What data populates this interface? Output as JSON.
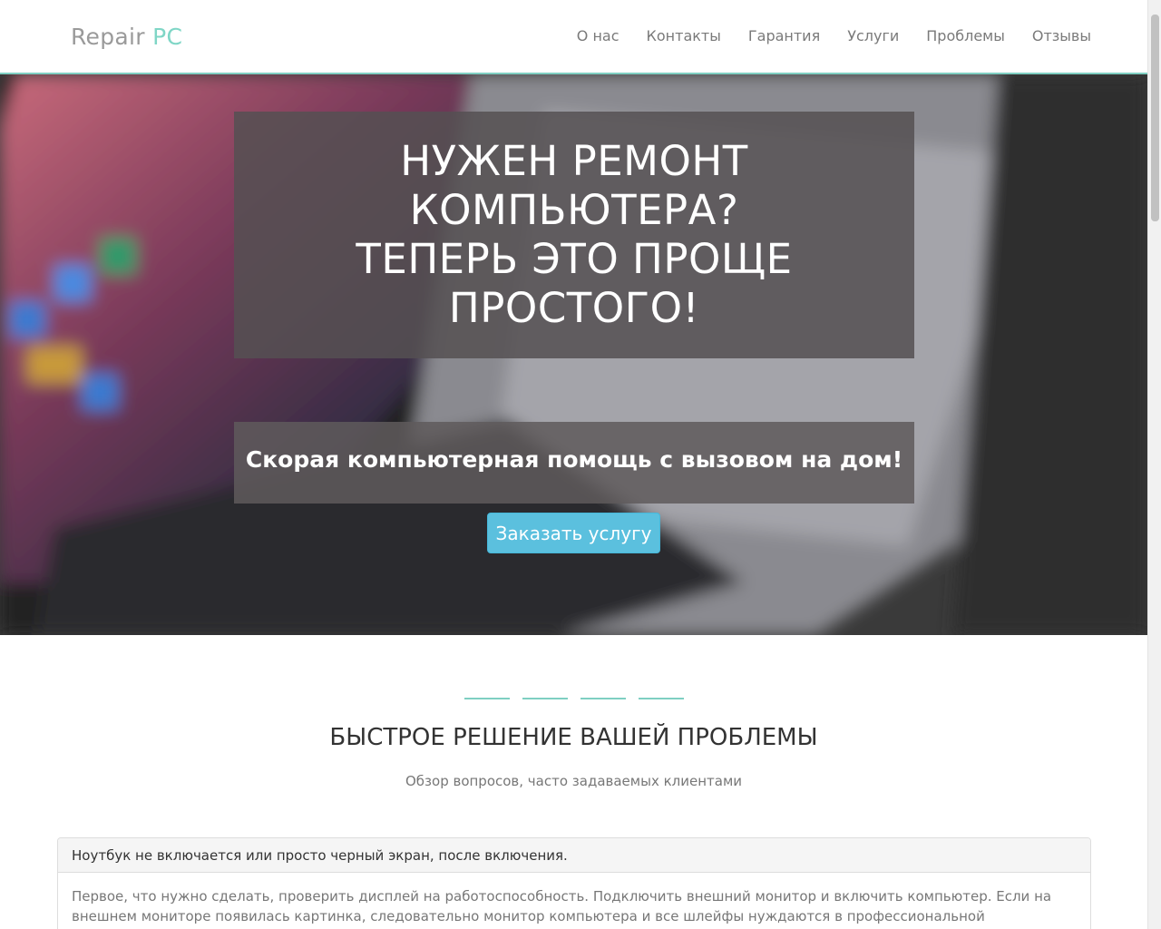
{
  "navbar": {
    "brand_main": "Repair",
    "brand_accent": "PC",
    "links": [
      "О нас",
      "Контакты",
      "Гарантия",
      "Услуги",
      "Проблемы",
      "Отзывы"
    ]
  },
  "hero": {
    "title_line1": "НУЖЕН РЕМОНТ",
    "title_line2": "КОМПЬЮТЕРА?",
    "title_line3": "ТЕПЕРЬ ЭТО ПРОЩЕ",
    "title_line4": "ПРОСТОГО!",
    "subtitle": "Скорая компьютерная помощь с вызовом на дом!",
    "cta_label": "Заказать услугу"
  },
  "section": {
    "title": "БЫСТРОЕ РЕШЕНИЕ ВАШЕЙ ПРОБЛЕМЫ",
    "subtitle": "Обзор вопросов, часто задаваемых клиентами"
  },
  "faq": [
    {
      "question": "Ноутбук не включается или просто черный экран, после включения.",
      "answer": "Первое, что нужно сделать, проверить дисплей на работоспособность. Подключить внешний монитор и включить компьютер. Если на внешнем мониторе появилась картинка, следовательно монитор компьютера и все шлейфы нуждаются в профессиональной диагностике, которую мы"
    }
  ],
  "colors": {
    "accent": "#7fcfc2",
    "cta": "#5bc0de"
  }
}
